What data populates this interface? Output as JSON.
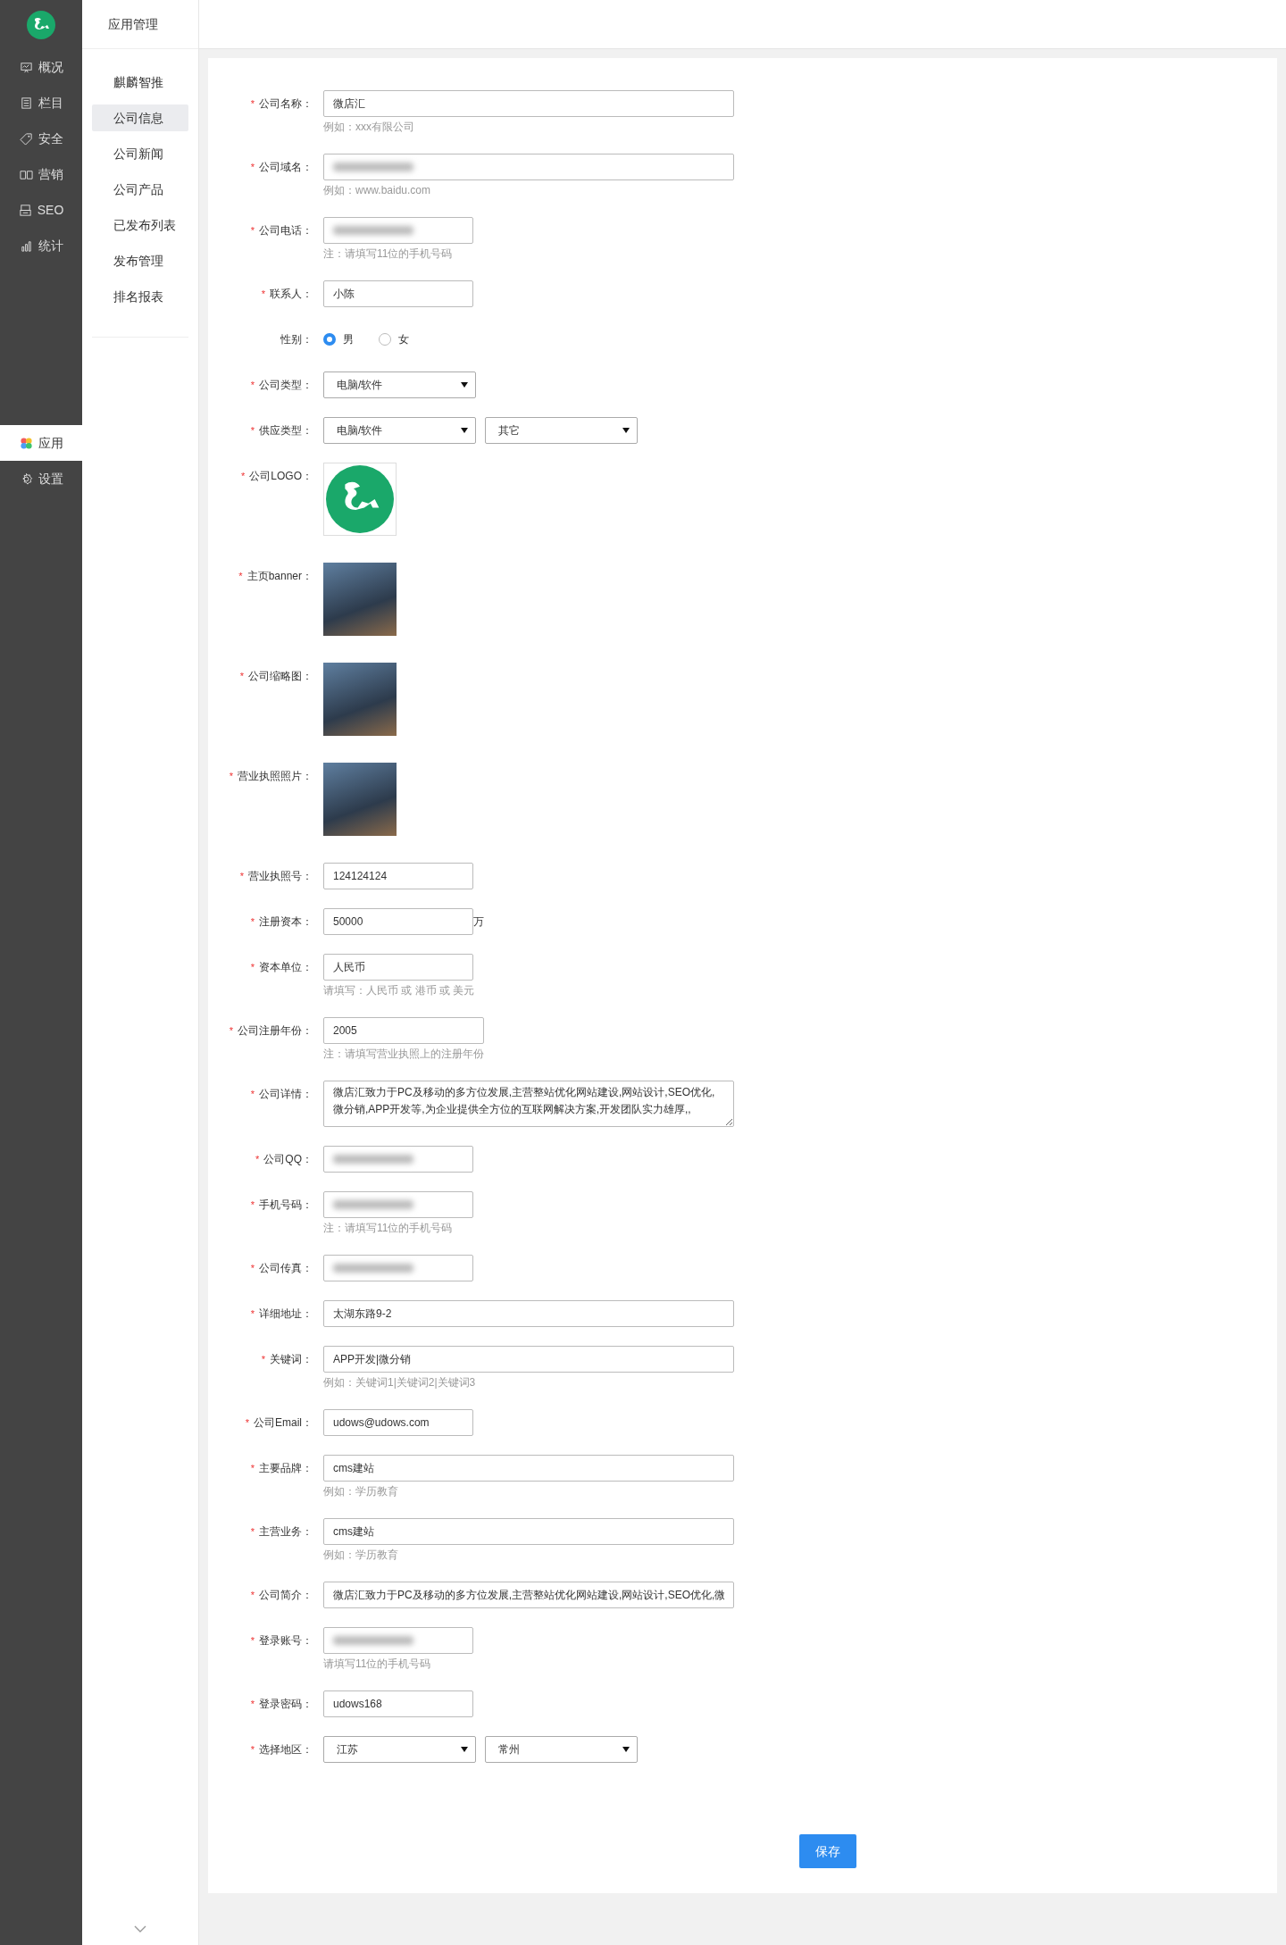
{
  "sidebar": {
    "top_items": [
      {
        "label": "概况",
        "selected": false
      },
      {
        "label": "栏目",
        "selected": false
      },
      {
        "label": "安全",
        "selected": false
      },
      {
        "label": "营销",
        "selected": false
      },
      {
        "label": "SEO",
        "selected": false
      },
      {
        "label": "统计",
        "selected": false
      }
    ],
    "bottom_items": [
      {
        "label": "应用",
        "selected": true
      },
      {
        "label": "设置",
        "selected": false
      }
    ]
  },
  "submenu": {
    "title": "应用管理",
    "items": [
      {
        "label": "麒麟智推",
        "selected": false
      },
      {
        "label": "公司信息",
        "selected": true
      },
      {
        "label": "公司新闻",
        "selected": false
      },
      {
        "label": "公司产品",
        "selected": false
      },
      {
        "label": "已发布列表",
        "selected": false
      },
      {
        "label": "发布管理",
        "selected": false
      },
      {
        "label": "排名报表",
        "selected": false
      }
    ]
  },
  "form": {
    "fields": [
      {
        "kind": "text",
        "label": "公司名称：",
        "mark": "*",
        "value": "微店汇",
        "hint": "例如：xxx有限公司"
      },
      {
        "kind": "text",
        "label": "公司域名：",
        "mark": "*",
        "blurred": true,
        "hint": "例如：www.baidu.com"
      },
      {
        "kind": "text",
        "label": "公司电话：",
        "mark": "*",
        "blurred": true,
        "hint": "注：请填写11位的手机号码"
      },
      {
        "kind": "text",
        "label": "联系人：",
        "mark": "*",
        "value": "小陈"
      },
      {
        "kind": "radio",
        "label": "性别：",
        "options": [
          {
            "label": "男",
            "selected": true
          },
          {
            "label": "女",
            "selected": false
          }
        ]
      },
      {
        "kind": "select",
        "label": "公司类型：",
        "mark": "*",
        "selects": [
          "电脑/软件"
        ]
      },
      {
        "kind": "select",
        "label": "供应类型：",
        "mark": "*",
        "selects": [
          "电脑/软件",
          "其它"
        ]
      },
      {
        "kind": "logo",
        "label": "公司LOGO：",
        "mark": "*"
      },
      {
        "kind": "photo",
        "label": "主页banner：",
        "mark": "*"
      },
      {
        "kind": "photo",
        "label": "公司缩略图：",
        "mark": "*"
      },
      {
        "kind": "photo",
        "label": "营业执照照片：",
        "mark": "*"
      },
      {
        "kind": "text",
        "label": "营业执照号：",
        "mark": "*",
        "value": "124124124"
      },
      {
        "kind": "text",
        "label": "注册资本：",
        "mark": "*",
        "value": "50000",
        "suffix": "万"
      },
      {
        "kind": "text",
        "label": "资本单位：",
        "mark": "*",
        "value": "人民币",
        "hint": "请填写：人民币 或 港币 或 美元"
      },
      {
        "kind": "text",
        "label": "公司注册年份：",
        "mark": "*",
        "value": "2005",
        "hint": "注：请填写营业执照上的注册年份"
      },
      {
        "kind": "textarea",
        "label": "公司详情：",
        "mark": "*",
        "value": "微店汇致力于PC及移动的多方位发展,主营整站优化网站建设,网站设计,SEO优化,微分销,APP开发等,为企业提供全方位的互联网解决方案,开发团队实力雄厚,,"
      },
      {
        "kind": "text",
        "label": "公司QQ：",
        "mark": "*",
        "blurred": true
      },
      {
        "kind": "text",
        "label": "手机号码：",
        "mark": "*",
        "blurred": true,
        "hint": "注：请填写11位的手机号码"
      },
      {
        "kind": "text",
        "label": "公司传真：",
        "mark": "*",
        "blurred": true
      },
      {
        "kind": "text",
        "label": "详细地址：",
        "mark": "*",
        "value": "太湖东路9-2"
      },
      {
        "kind": "text",
        "label": "关键词：",
        "mark": "*",
        "value": "APP开发|微分销",
        "hint": "例如：关键词1|关键词2|关键词3"
      },
      {
        "kind": "text",
        "label": "公司Email：",
        "mark": "*",
        "value": "udows@udows.com"
      },
      {
        "kind": "text",
        "label": "主要品牌：",
        "mark": "*",
        "value": "cms建站",
        "hint": "例如：学历教育"
      },
      {
        "kind": "text",
        "label": "主营业务：",
        "mark": "*",
        "value": "cms建站",
        "hint": "例如：学历教育"
      },
      {
        "kind": "text",
        "label": "公司简介：",
        "mark": "*",
        "value": "微店汇致力于PC及移动的多方位发展,主营整站优化网站建设,网站设计,SEO优化,微"
      },
      {
        "kind": "text",
        "label": "登录账号：",
        "mark": "*",
        "blurred": true,
        "hint": "请填写11位的手机号码"
      },
      {
        "kind": "text",
        "label": "登录密码：",
        "mark": "*",
        "value": "udows168"
      },
      {
        "kind": "select",
        "label": "选择地区：",
        "mark": "*",
        "selects": [
          "江苏",
          "常州"
        ]
      }
    ],
    "save_button": "保存"
  }
}
